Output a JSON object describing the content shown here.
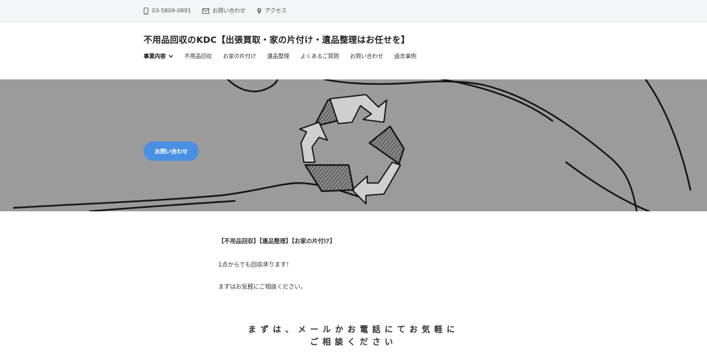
{
  "topbar": {
    "phone": "03-5809-0891",
    "contact": "お問い合わせ",
    "access": "アクセス",
    "icons": [
      "phone-icon",
      "mail-icon",
      "map-pin-icon"
    ]
  },
  "header": {
    "site_title": "不用品回収のKDC【出張買取・家の片付け・遺品整理はお任せを】",
    "nav": [
      {
        "label": "事業内容"
      },
      {
        "label": "不用品回収"
      },
      {
        "label": "お家の片付け"
      },
      {
        "label": "遺品整理"
      },
      {
        "label": "よくあるご質問"
      },
      {
        "label": "お問い合わせ"
      },
      {
        "label": "過去事例"
      }
    ]
  },
  "hero": {
    "button_label": "お問い合わせ",
    "button_color": "#4a90e2",
    "background_color": "#9b9b9b"
  },
  "content": {
    "heading": "【不用品回収】【遺品整理】【お家の片付け】",
    "line1": "1点からでも回収承ります！",
    "line2": "まずはお気軽にご相談ください。"
  },
  "cta": {
    "line1": "まずは、メールかお電話にてお気軽に",
    "line2": "ご相談ください"
  }
}
